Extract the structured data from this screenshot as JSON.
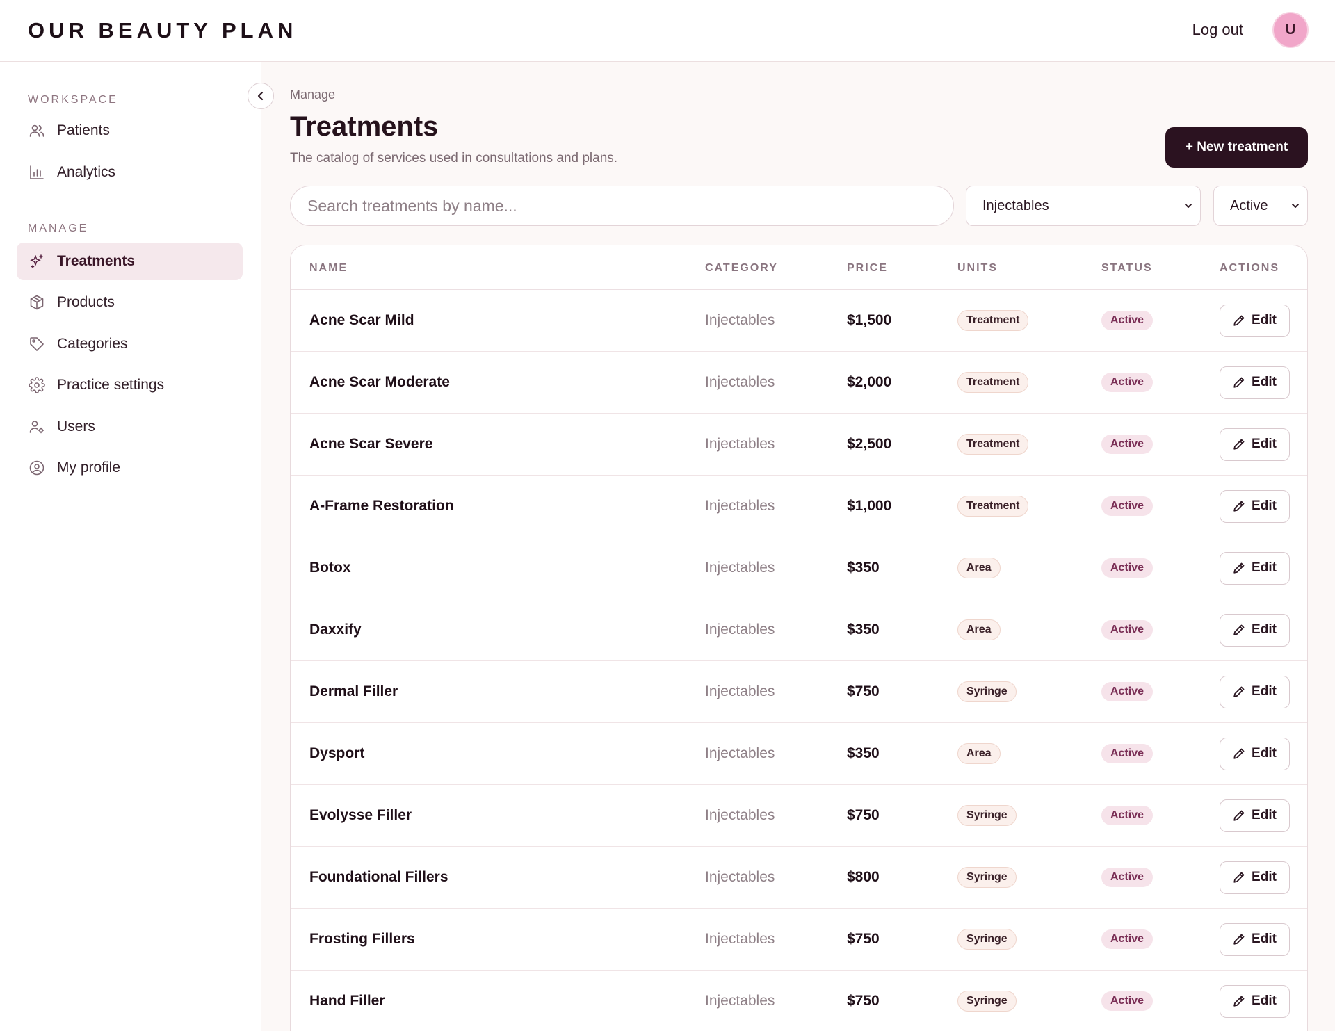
{
  "app": {
    "brand": "OUR BEAUTY PLAN"
  },
  "header": {
    "logout_label": "Log out",
    "avatar_initial": "U"
  },
  "sidebar": {
    "workspace_label": "WORKSPACE",
    "manage_label": "MANAGE",
    "workspace_items": [
      {
        "label": "Patients",
        "icon": "users-icon"
      },
      {
        "label": "Analytics",
        "icon": "bar-chart-icon"
      }
    ],
    "manage_items": [
      {
        "label": "Treatments",
        "icon": "sparkles-icon",
        "active": true
      },
      {
        "label": "Products",
        "icon": "package-icon"
      },
      {
        "label": "Categories",
        "icon": "tag-icon"
      },
      {
        "label": "Practice settings",
        "icon": "gear-icon"
      },
      {
        "label": "Users",
        "icon": "user-cog-icon"
      },
      {
        "label": "My profile",
        "icon": "user-circle-icon"
      }
    ]
  },
  "main": {
    "breadcrumb": "Manage",
    "title": "Treatments",
    "subtitle": "The catalog of services used in consultations and plans.",
    "new_button_label": "+ New treatment",
    "search": {
      "placeholder": "Search treatments by name...",
      "value": ""
    },
    "category_filter": {
      "selected": "Injectables"
    },
    "status_filter": {
      "selected": "Active"
    }
  },
  "table": {
    "columns": [
      "NAME",
      "CATEGORY",
      "PRICE",
      "UNITS",
      "STATUS",
      "ACTIONS"
    ],
    "edit_label": "Edit",
    "rows": [
      {
        "name": "Acne Scar Mild",
        "category": "Injectables",
        "price": "$1,500",
        "unit": "Treatment",
        "status": "Active"
      },
      {
        "name": "Acne Scar Moderate",
        "category": "Injectables",
        "price": "$2,000",
        "unit": "Treatment",
        "status": "Active"
      },
      {
        "name": "Acne Scar Severe",
        "category": "Injectables",
        "price": "$2,500",
        "unit": "Treatment",
        "status": "Active"
      },
      {
        "name": "A-Frame Restoration",
        "category": "Injectables",
        "price": "$1,000",
        "unit": "Treatment",
        "status": "Active"
      },
      {
        "name": "Botox",
        "category": "Injectables",
        "price": "$350",
        "unit": "Area",
        "status": "Active"
      },
      {
        "name": "Daxxify",
        "category": "Injectables",
        "price": "$350",
        "unit": "Area",
        "status": "Active"
      },
      {
        "name": "Dermal Filler",
        "category": "Injectables",
        "price": "$750",
        "unit": "Syringe",
        "status": "Active"
      },
      {
        "name": "Dysport",
        "category": "Injectables",
        "price": "$350",
        "unit": "Area",
        "status": "Active"
      },
      {
        "name": "Evolysse Filler",
        "category": "Injectables",
        "price": "$750",
        "unit": "Syringe",
        "status": "Active"
      },
      {
        "name": "Foundational Fillers",
        "category": "Injectables",
        "price": "$800",
        "unit": "Syringe",
        "status": "Active"
      },
      {
        "name": "Frosting Fillers",
        "category": "Injectables",
        "price": "$750",
        "unit": "Syringe",
        "status": "Active"
      },
      {
        "name": "Hand Filler",
        "category": "Injectables",
        "price": "$750",
        "unit": "Syringe",
        "status": "Active"
      }
    ]
  },
  "colors": {
    "accent_dark": "#2b1220",
    "active_nav_bg": "#f5e8ec",
    "status_pill_bg": "#f6e3ea",
    "avatar_bg": "#f1a6c9"
  }
}
